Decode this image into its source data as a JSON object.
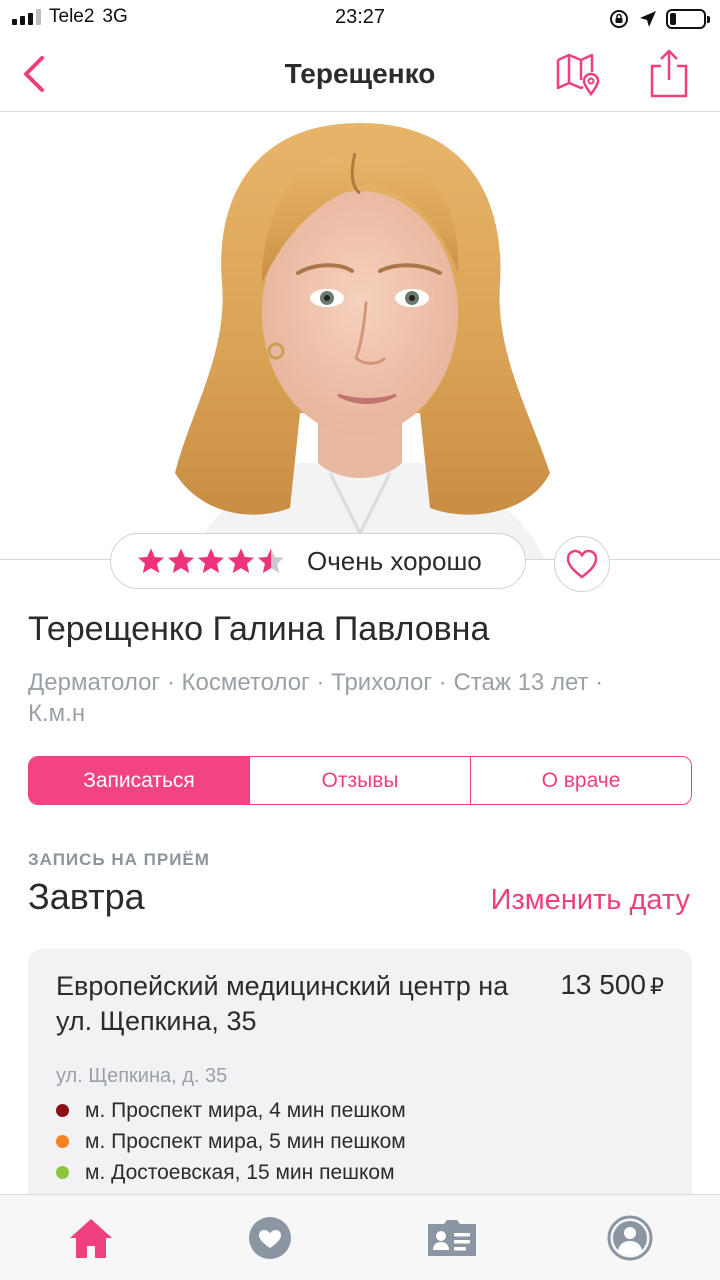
{
  "status_bar": {
    "carrier": "Tele2",
    "network": "3G",
    "time": "23:27",
    "battery_level": 0.2
  },
  "nav": {
    "title": "Терещенко",
    "back_icon": "chevron-left-icon",
    "map_icon": "map-pin-icon",
    "share_icon": "share-icon"
  },
  "photo": {
    "subject": "doctor-portrait"
  },
  "rating": {
    "stars": 4.5,
    "max_stars": 5,
    "label": "Очень хорошо"
  },
  "doctor": {
    "name": "Терещенко Галина Павловна",
    "specialties": "Дерматолог · Косметолог · Трихолог · Стаж 13 лет · К.м.н"
  },
  "tabs": [
    {
      "label": "Записаться",
      "active": true
    },
    {
      "label": "Отзывы",
      "active": false
    },
    {
      "label": "О враче",
      "active": false
    }
  ],
  "booking": {
    "caption": "ЗАПИСЬ НА ПРИЁМ",
    "date": "Завтра",
    "change_date": "Изменить дату"
  },
  "clinic": {
    "name": "Европейский медицинский центр на ул. Щепкина, 35",
    "price": "13 500",
    "currency": "₽",
    "address": "ул. Щепкина, д. 35",
    "metro": [
      {
        "text": "м. Проспект мира, 4 мин пешком",
        "color": "#8b0f14"
      },
      {
        "text": "м. Проспект мира, 5 мин пешком",
        "color": "#f58220"
      },
      {
        "text": "м. Достоевская, 15 мин пешком",
        "color": "#8cc63f"
      }
    ]
  },
  "tab_bar": [
    {
      "icon": "home-icon",
      "active": true
    },
    {
      "icon": "heart-icon",
      "active": false
    },
    {
      "icon": "contact-card-icon",
      "active": false
    },
    {
      "icon": "profile-icon",
      "active": false
    }
  ],
  "colors": {
    "accent": "#ee3f7e",
    "star": "#f0327a",
    "muted_text": "#9aa0a8"
  }
}
